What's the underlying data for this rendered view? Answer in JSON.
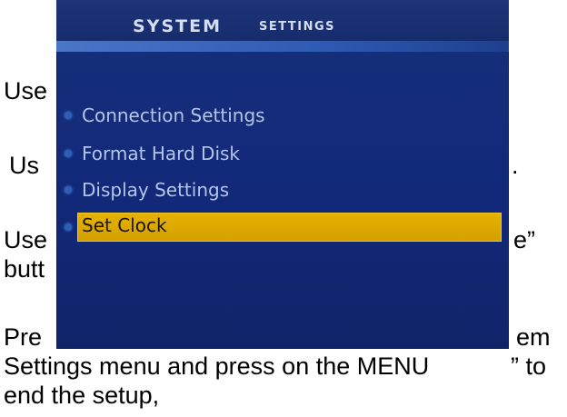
{
  "document": {
    "line1": "Use",
    "line2": "Us",
    "dot": ".",
    "line3": "Use",
    "line3_end": "e”",
    "line4": "butt",
    "line5": "Pre",
    "line5_end": "em",
    "line6": "Settings  menu and press on the  MENU",
    "line6_end": "” to",
    "line7": "end the setup,"
  },
  "menu": {
    "title_main": "SYSTEM",
    "title_sub": "SETTINGS",
    "items": [
      {
        "label": "Connection Settings",
        "selected": false
      },
      {
        "label": "Format Hard Disk",
        "selected": false
      },
      {
        "label": "Display Settings",
        "selected": false
      },
      {
        "label": "Set Clock",
        "selected": true
      }
    ],
    "colors": {
      "panel": "#12297a",
      "header_underline": "#2d5ab2",
      "highlight": "#dba800",
      "item_text": "#b4c6e8"
    }
  }
}
